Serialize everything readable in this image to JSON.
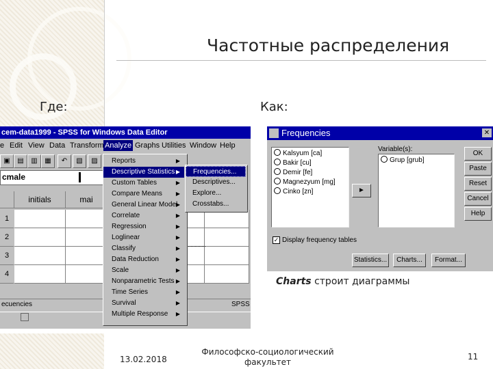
{
  "slide": {
    "title": "Частотные распределения",
    "where_label": "Где:",
    "how_label": "Как:",
    "caption_bold": "Charts",
    "caption_rest": " строит диаграммы",
    "footer_date": "13.02.2018",
    "footer_faculty_line1": "Философско-социологический",
    "footer_faculty_line2": "факультет",
    "page_number": "11"
  },
  "spss": {
    "title": "cem-data1999 - SPSS for Windows Data Editor",
    "menus": [
      "e",
      "Edit",
      "View",
      "Data",
      "Transform",
      "Analyze",
      "Graphs",
      "Utilities",
      "Window",
      "Help"
    ],
    "cell_name": "cmale",
    "columns": [
      "initials",
      "mai"
    ],
    "rows": [
      "1",
      "2",
      "3",
      "4"
    ],
    "tab_label": "ecuencies",
    "status": "SPSS",
    "analyze_menu": [
      "Reports",
      "Descriptive Statistics",
      "Custom Tables",
      "Compare Means",
      "General Linear Model",
      "Correlate",
      "Regression",
      "Loglinear",
      "Classify",
      "Data Reduction",
      "Scale",
      "Nonparametric Tests",
      "Time Series",
      "Survival",
      "Multiple Response"
    ],
    "descriptive_submenu": [
      "Frequencies...",
      "Descriptives...",
      "Explore...",
      "Crosstabs..."
    ]
  },
  "dialog": {
    "title": "Frequencies",
    "source_vars": [
      "Kalsyum [ca]",
      "Bakir [cu]",
      "Demir [fe]",
      "Magnezyum [mg]",
      "Cinko [zn]"
    ],
    "variables_label": "Variable(s):",
    "selected_vars": [
      "Grup [grub]"
    ],
    "move_glyph": "►",
    "buttons": [
      "OK",
      "Paste",
      "Reset",
      "Cancel",
      "Help"
    ],
    "checkbox_label": "Display frequency tables",
    "bottom_buttons": [
      "Statistics...",
      "Charts...",
      "Format..."
    ]
  }
}
